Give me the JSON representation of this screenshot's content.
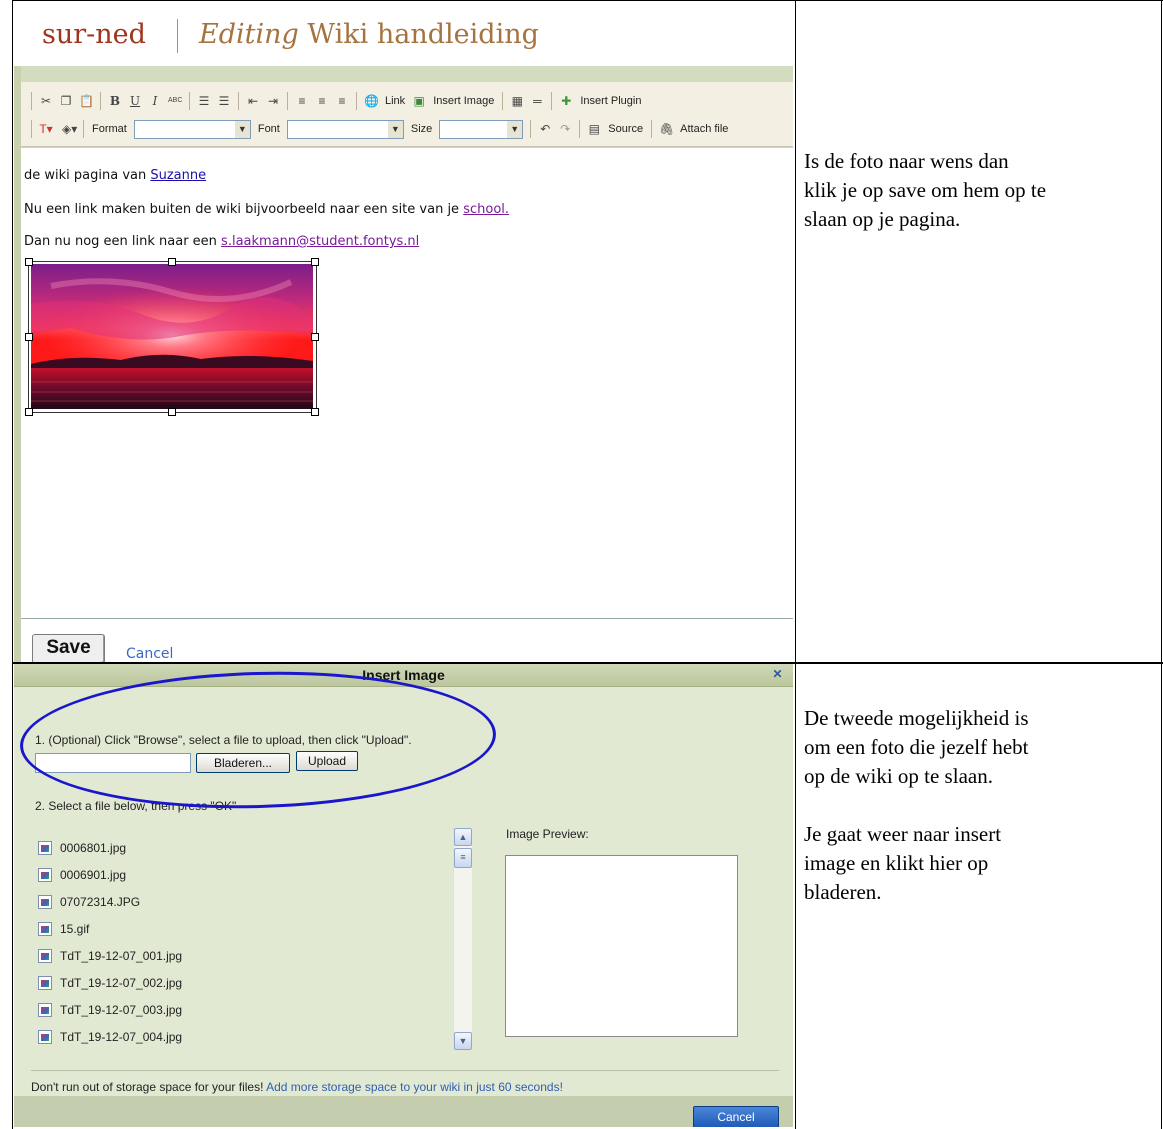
{
  "top_instruction": {
    "lines": [
      "Is de foto naar wens dan",
      "klik je op save om hem op te",
      "slaan op je pagina."
    ]
  },
  "bottom_instruction": {
    "para1": [
      "De tweede mogelijkheid is",
      "om een foto die jezelf hebt",
      "op de wiki op te slaan."
    ],
    "para2": [
      "Je gaat weer naar insert",
      "image en klikt hier op",
      "bladeren."
    ]
  },
  "editor": {
    "site_name": "sur-ned",
    "editing_word": "Editing",
    "page_name": "Wiki handleiding",
    "toolbar": {
      "link_label": "Link",
      "insert_image_label": "Insert Image",
      "insert_plugin_label": "Insert Plugin",
      "format_label": "Format",
      "font_label": "Font",
      "size_label": "Size",
      "source_label": "Source",
      "attach_file_label": "Attach file",
      "format_value": "",
      "font_value": "",
      "size_value": ""
    },
    "content": {
      "line1_text": "de wiki pagina van ",
      "line1_link": "Suzanne",
      "line2_text": "Nu een link maken buiten de wiki bijvoorbeeld naar een site van je ",
      "line2_link": "school.",
      "line3_text": "Dan nu nog een link naar een ",
      "line3_link": "s.laakmann@student.fontys.nl"
    },
    "save_label": "Save",
    "cancel_label": "Cancel"
  },
  "dialog": {
    "title": "Insert Image",
    "step1": "1. (Optional) Click \"Browse\", select a file to upload, then click \"Upload\".",
    "file_input_value": "",
    "browse_label": "Bladeren...",
    "upload_label": "Upload",
    "step2": "2. Select a file below, then press \"OK\"",
    "preview_label": "Image Preview:",
    "files": [
      "0006801.jpg",
      "0006901.jpg",
      "07072314.JPG",
      "15.gif",
      "TdT_19-12-07_001.jpg",
      "TdT_19-12-07_002.jpg",
      "TdT_19-12-07_003.jpg",
      "TdT_19-12-07_004.jpg"
    ],
    "storage_text": "Don't run out of storage space for your files! ",
    "storage_link": "Add more storage space to your wiki in just 60 seconds!",
    "cancel_label": "Cancel"
  },
  "colors": {
    "site_name": "#a0341d",
    "editing_title": "#a5733f",
    "dialog_bg": "#e2e9d3",
    "annotation_oval": "#1a16cc",
    "link": "#1a0dab",
    "visited_link": "#7a1a9a"
  }
}
